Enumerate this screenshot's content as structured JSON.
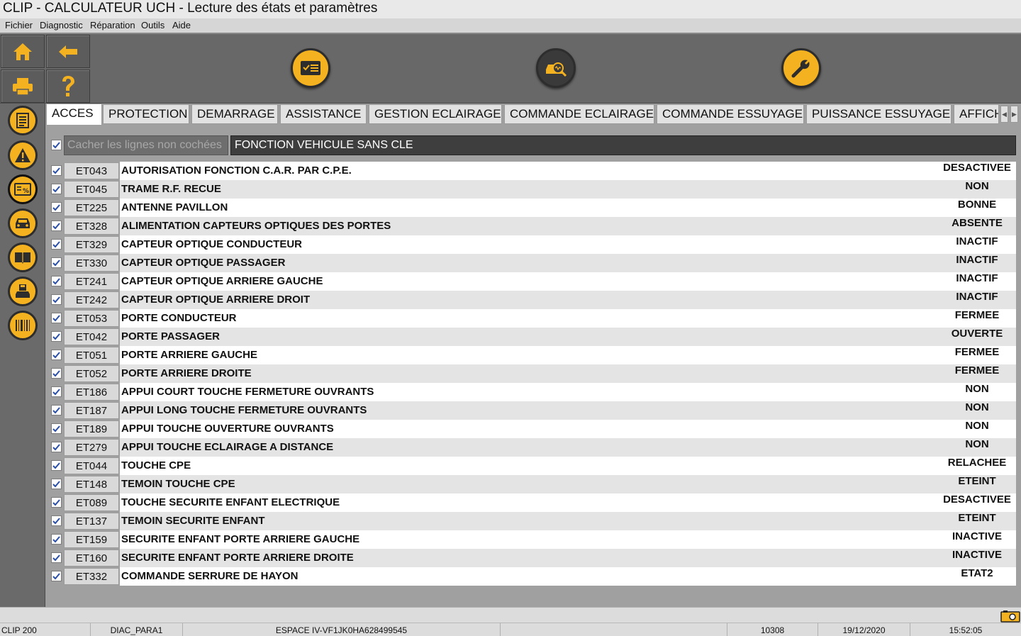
{
  "window": {
    "title": "CLIP - CALCULATEUR UCH - Lecture des états et paramètres"
  },
  "menu": [
    "Fichier",
    "Diagnostic",
    "Réparation",
    "Outils",
    "Aide"
  ],
  "colors": {
    "accent": "#f4b221",
    "toolbar": "#686868",
    "selected_row": "#e4e4e4"
  },
  "toolbar": {
    "nav_icons": [
      "home-icon",
      "back-arrow-icon",
      "printer-icon",
      "help-icon"
    ],
    "center_icons": [
      "checklist-icon",
      "vehicle-diagnostic-icon",
      "wrench-icon"
    ]
  },
  "sidebar": {
    "icons": [
      "document-list-icon",
      "warning-icon",
      "parameters-icon",
      "vehicle-icon",
      "manual-book-icon",
      "save-vehicle-icon",
      "barcode-icon"
    ]
  },
  "tabs": [
    "ACCES",
    "PROTECTION",
    "DEMARRAGE",
    "ASSISTANCE",
    "GESTION ECLAIRAGE",
    "COMMANDE ECLAIRAGE",
    "COMMANDE ESSUYAGE",
    "PUISSANCE ESSUYAGE",
    "AFFICH"
  ],
  "active_tab": "ACCES",
  "filter": {
    "hide_label": "Cacher les lignes non cochées",
    "hide_checked": true,
    "function_title": "FONCTION VEHICULE SANS CLE"
  },
  "rows": [
    {
      "code": "ET043",
      "label": "AUTORISATION FONCTION C.A.R. PAR C.P.E.",
      "value": "DESACTIVEE",
      "checked": true
    },
    {
      "code": "ET045",
      "label": "TRAME R.F. RECUE",
      "value": "NON",
      "checked": true
    },
    {
      "code": "ET225",
      "label": "ANTENNE PAVILLON",
      "value": "BONNE",
      "checked": true
    },
    {
      "code": "ET328",
      "label": "ALIMENTATION CAPTEURS OPTIQUES DES PORTES",
      "value": "ABSENTE",
      "checked": true
    },
    {
      "code": "ET329",
      "label": "CAPTEUR OPTIQUE CONDUCTEUR",
      "value": "INACTIF",
      "checked": true
    },
    {
      "code": "ET330",
      "label": "CAPTEUR OPTIQUE PASSAGER",
      "value": "INACTIF",
      "checked": true
    },
    {
      "code": "ET241",
      "label": "CAPTEUR OPTIQUE ARRIERE GAUCHE",
      "value": "INACTIF",
      "checked": true
    },
    {
      "code": "ET242",
      "label": "CAPTEUR OPTIQUE ARRIERE DROIT",
      "value": "INACTIF",
      "checked": true
    },
    {
      "code": "ET053",
      "label": "PORTE CONDUCTEUR",
      "value": "FERMEE",
      "checked": true
    },
    {
      "code": "ET042",
      "label": "PORTE PASSAGER",
      "value": "OUVERTE",
      "checked": true
    },
    {
      "code": "ET051",
      "label": "PORTE ARRIERE GAUCHE",
      "value": "FERMEE",
      "checked": true
    },
    {
      "code": "ET052",
      "label": "PORTE ARRIERE DROITE",
      "value": "FERMEE",
      "checked": true
    },
    {
      "code": "ET186",
      "label": "APPUI COURT TOUCHE FERMETURE OUVRANTS",
      "value": "NON",
      "checked": true
    },
    {
      "code": "ET187",
      "label": "APPUI LONG TOUCHE FERMETURE OUVRANTS",
      "value": "NON",
      "checked": true
    },
    {
      "code": "ET189",
      "label": "APPUI TOUCHE OUVERTURE OUVRANTS",
      "value": "NON",
      "checked": true
    },
    {
      "code": "ET279",
      "label": "APPUI TOUCHE ECLAIRAGE A DISTANCE",
      "value": "NON",
      "checked": true
    },
    {
      "code": "ET044",
      "label": "TOUCHE CPE",
      "value": "RELACHEE",
      "checked": true
    },
    {
      "code": "ET148",
      "label": "TEMOIN TOUCHE CPE",
      "value": "ETEINT",
      "checked": true
    },
    {
      "code": "ET089",
      "label": "TOUCHE SECURITE ENFANT ELECTRIQUE",
      "value": "DESACTIVEE",
      "checked": true
    },
    {
      "code": "ET137",
      "label": "TEMOIN SECURITE ENFANT",
      "value": "ETEINT",
      "checked": true
    },
    {
      "code": "ET159",
      "label": "SECURITE ENFANT PORTE ARRIERE GAUCHE",
      "value": "INACTIVE",
      "checked": true
    },
    {
      "code": "ET160",
      "label": "SECURITE ENFANT PORTE ARRIERE DROITE",
      "value": "INACTIVE",
      "checked": true
    },
    {
      "code": "ET332",
      "label": "COMMANDE SERRURE DE HAYON",
      "value": "ETAT2",
      "checked": true
    }
  ],
  "status": {
    "device": "CLIP 200",
    "profile": "DIAC_PARA1",
    "vehicle": "ESPACE IV-VF1JK0HA628499545",
    "counter": "10308",
    "date": "19/12/2020",
    "time": "15:52:05"
  }
}
